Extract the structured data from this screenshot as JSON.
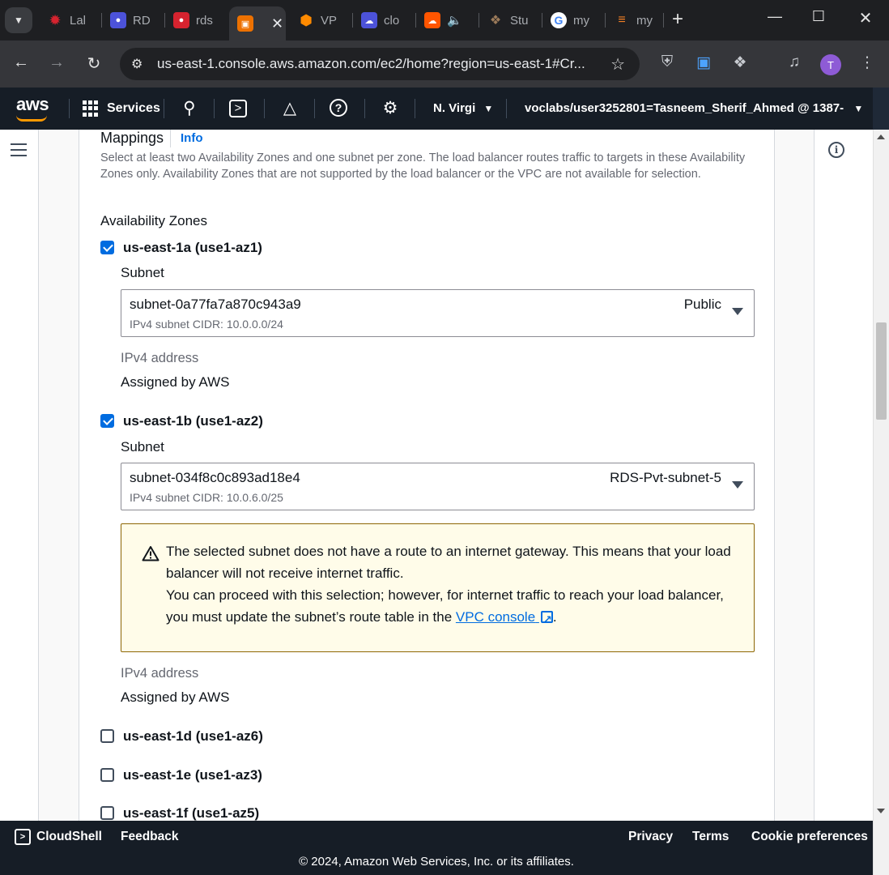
{
  "browser": {
    "tabs": [
      {
        "label": "Lal",
        "icon": "lab-icon",
        "color": "#c92a2a"
      },
      {
        "label": "RD",
        "icon": "rds-icon",
        "color": "#4c52d9"
      },
      {
        "label": "rds",
        "icon": "rds-icon",
        "color": "#d6232f"
      },
      {
        "label": "",
        "icon": "ec2-icon",
        "color": "#ed7100",
        "active": true
      },
      {
        "label": "VP",
        "icon": "vpc-icon",
        "color": "#ff8a00"
      },
      {
        "label": "clo",
        "icon": "cloud-icon",
        "color": "#4c52d9"
      },
      {
        "label": "",
        "icon": "soundcloud-icon",
        "color": "#ff5500"
      },
      {
        "label": "Stu",
        "icon": "studio-icon",
        "color": "#7a5c3d"
      },
      {
        "label": "my",
        "icon": "google-icon",
        "color": "#ffffff"
      },
      {
        "label": "my",
        "icon": "stackoverflow-icon",
        "color": "#f48024"
      }
    ],
    "url": "us-east-1.console.aws.amazon.com/ec2/home?region=us-east-1#Cr...",
    "profile_initial": "T"
  },
  "aws_nav": {
    "logo": "aws",
    "services_label": "Services",
    "region": "N. Virgi",
    "account": "voclabs/user3252801=Tasneem_Sherif_Ahmed @ 1387-"
  },
  "mappings": {
    "title": "Mappings",
    "info_label": "Info",
    "description": "Select at least two Availability Zones and one subnet per zone. The load balancer routes traffic to targets in these Availability Zones only. Availability Zones that are not supported by the load balancer or the VPC are not available for selection.",
    "az_heading": "Availability Zones",
    "subnet_label": "Subnet",
    "ipv4_label": "IPv4 address",
    "zones": [
      {
        "name": "us-east-1a (use1-az1)",
        "checked": true,
        "subnet_id": "subnet-0a77fa7a870c943a9",
        "subnet_cidr": "IPv4 subnet CIDR: 10.0.0.0/24",
        "subnet_tag": "Public",
        "ipv4_value": "Assigned by AWS"
      },
      {
        "name": "us-east-1b (use1-az2)",
        "checked": true,
        "subnet_id": "subnet-034f8c0c893ad18e4",
        "subnet_cidr": "IPv4 subnet CIDR: 10.0.6.0/25",
        "subnet_tag": "RDS-Pvt-subnet-5",
        "ipv4_value": "Assigned by AWS"
      },
      {
        "name": "us-east-1d (use1-az6)",
        "checked": false
      },
      {
        "name": "us-east-1e (use1-az3)",
        "checked": false
      },
      {
        "name": "us-east-1f (use1-az5)",
        "checked": false
      }
    ],
    "warning": {
      "line1": "The selected subnet does not have a route to an internet gateway. This means that your load balancer will not receive internet traffic.",
      "line2_prefix": "You can proceed with this selection; however, for internet traffic to reach your load balancer, you must update the subnet’s route table in the",
      "link_text": "VPC console",
      "line2_suffix": "."
    }
  },
  "footer": {
    "cloudshell": "CloudShell",
    "feedback": "Feedback",
    "privacy": "Privacy",
    "terms": "Terms",
    "cookies": "Cookie preferences",
    "copyright": "© 2024, Amazon Web Services, Inc. or its affiliates."
  },
  "colors": {
    "aws_nav_bg": "#161d26",
    "link_blue": "#006ce0",
    "aws_orange": "#ff9900",
    "warning_bg": "#fffce9",
    "warning_border": "#8d6605"
  }
}
